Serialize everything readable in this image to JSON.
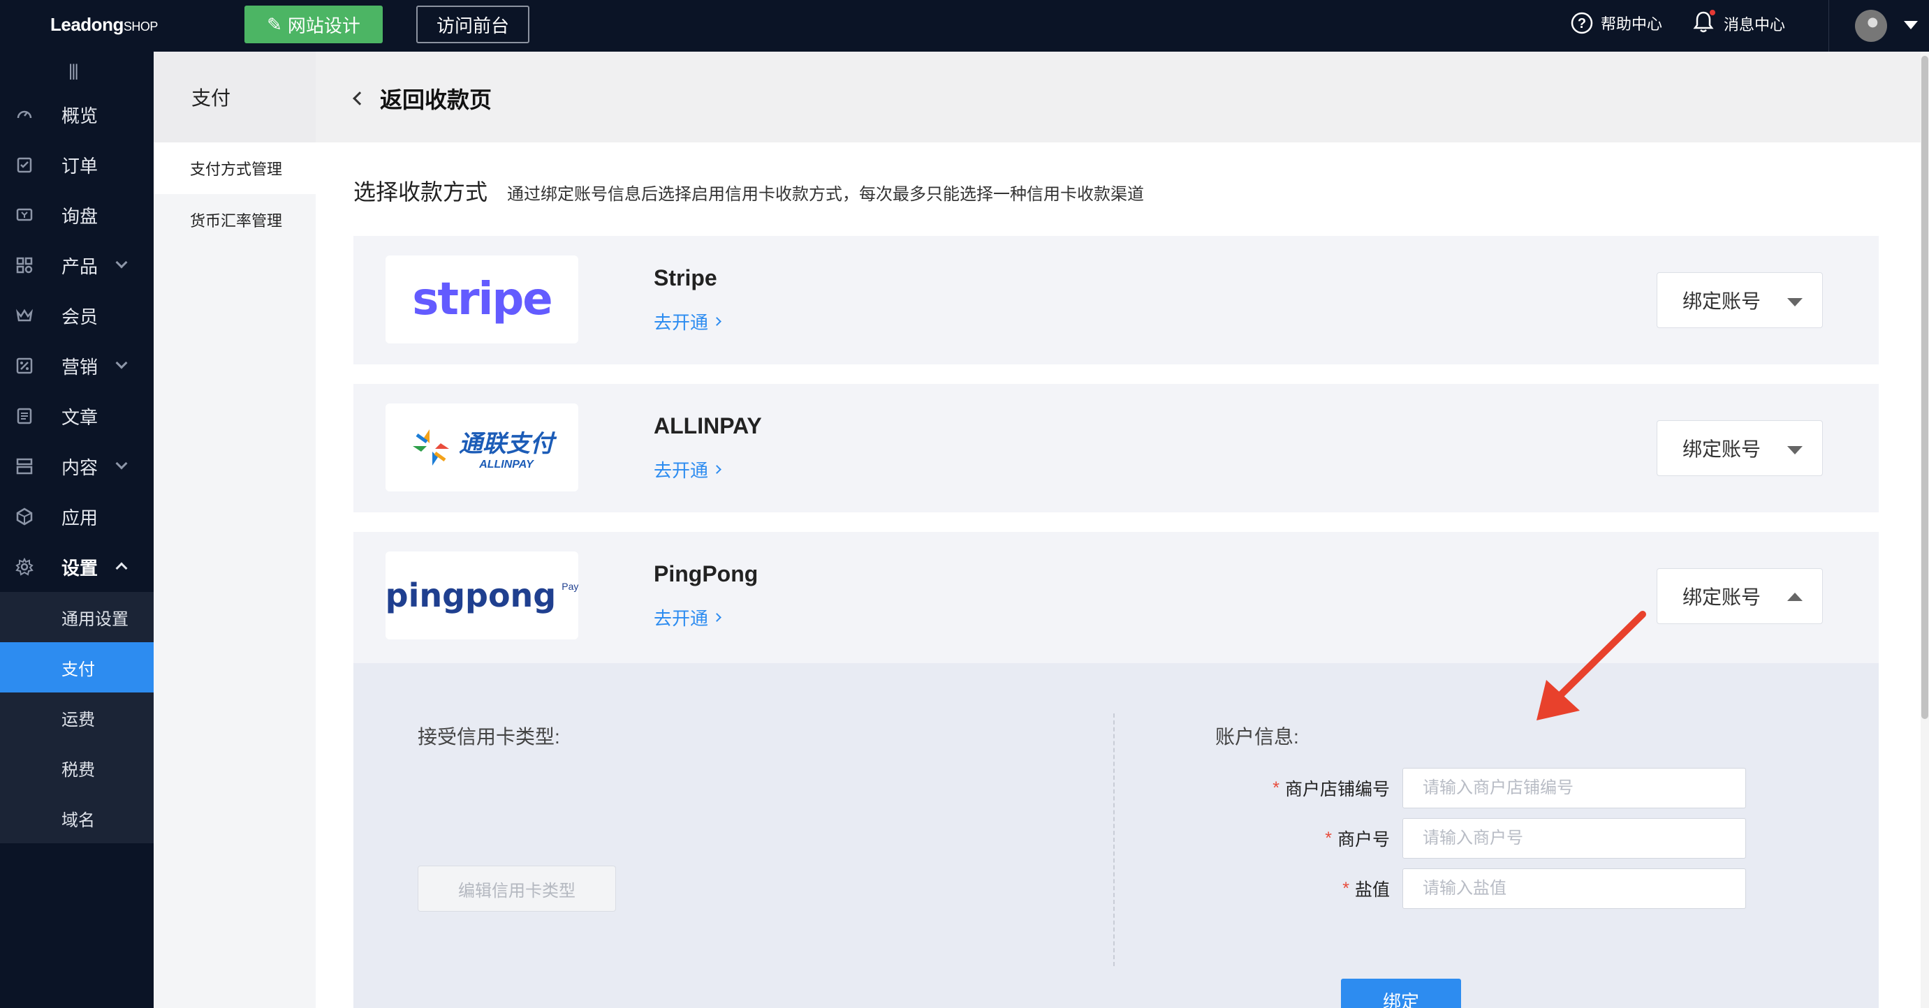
{
  "topbar": {
    "logo_main": "Leadong",
    "logo_sub": "SHOP",
    "design_button": "网站设计",
    "visit_button": "访问前台",
    "help": "帮助中心",
    "messages": "消息中心"
  },
  "sidebar": {
    "collapse_glyph": "|||",
    "items": [
      {
        "label": "概览",
        "icon": "dashboard-icon"
      },
      {
        "label": "订单",
        "icon": "order-icon"
      },
      {
        "label": "询盘",
        "icon": "inquiry-icon"
      },
      {
        "label": "产品",
        "icon": "product-icon"
      },
      {
        "label": "会员",
        "icon": "member-icon"
      },
      {
        "label": "营销",
        "icon": "marketing-icon"
      },
      {
        "label": "文章",
        "icon": "article-icon"
      },
      {
        "label": "内容",
        "icon": "content-icon"
      },
      {
        "label": "应用",
        "icon": "app-icon"
      },
      {
        "label": "设置",
        "icon": "settings-icon"
      }
    ],
    "sub_items": [
      "通用设置",
      "支付",
      "运费",
      "税费",
      "域名"
    ]
  },
  "sidebar2": {
    "title": "支付",
    "items": [
      "支付方式管理",
      "货币汇率管理"
    ]
  },
  "main": {
    "back_label": "返回收款页",
    "section_title": "选择收款方式",
    "section_desc": "通过绑定账号信息后选择启用信用卡收款方式，每次最多只能选择一种信用卡收款渠道",
    "providers": [
      {
        "name": "Stripe",
        "logo_text": "stripe",
        "link": "去开通",
        "bind": "绑定账号"
      },
      {
        "name": "ALLINPAY",
        "logo_text": "通联支付",
        "logo_sub": "ALLINPAY",
        "link": "去开通",
        "bind": "绑定账号"
      },
      {
        "name": "PingPong",
        "logo_text": "pingpong",
        "logo_sub": "Pay",
        "link": "去开通",
        "bind": "绑定账号"
      }
    ],
    "expanded": {
      "card_types_title": "接受信用卡类型:",
      "edit_card_types": "编辑信用卡类型",
      "account_title": "账户信息:",
      "fields": [
        {
          "label": "商户店铺编号",
          "placeholder": "请输入商户店铺编号",
          "required": "*"
        },
        {
          "label": "商户号",
          "placeholder": "请输入商户号",
          "required": "*"
        },
        {
          "label": "盐值",
          "placeholder": "请输入盐值",
          "required": "*"
        }
      ],
      "submit": "绑定"
    }
  },
  "colors": {
    "topbar": "#0b1426",
    "accent": "#2d8cf0",
    "design_button": "#4cb564",
    "annotation_arrow": "#e8412c"
  }
}
